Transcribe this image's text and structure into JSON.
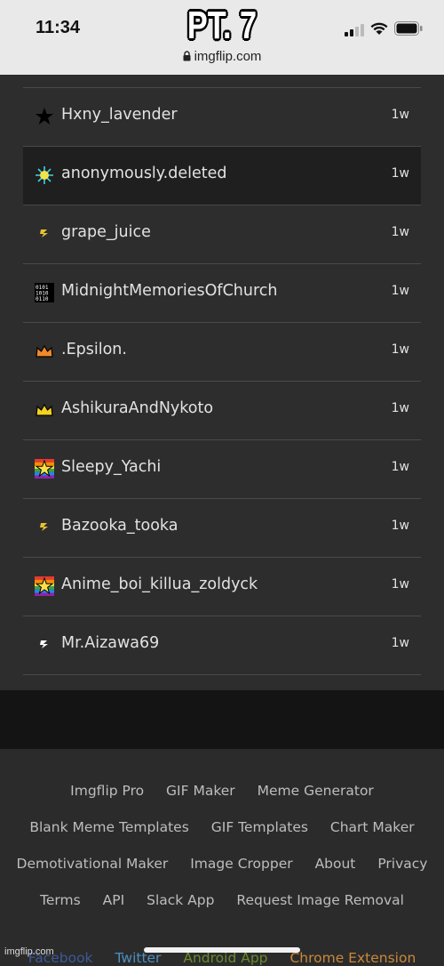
{
  "status": {
    "time": "11:34",
    "url": "imgflip.com"
  },
  "caption": "PT. 7",
  "users": [
    {
      "name": "Hxny_lavender",
      "time": "1w",
      "icon": "star-icon",
      "active": false
    },
    {
      "name": "anonymously.deleted",
      "time": "1w",
      "icon": "sun-icon",
      "active": true
    },
    {
      "name": "grape_juice",
      "time": "1w",
      "icon": "bolt-icon",
      "active": false
    },
    {
      "name": "MidnightMemoriesOfChurch",
      "time": "1w",
      "icon": "binary-icon",
      "active": false
    },
    {
      "name": ".Epsilon.",
      "time": "1w",
      "icon": "crown-orange-icon",
      "active": false
    },
    {
      "name": "AshikuraAndNykoto",
      "time": "1w",
      "icon": "crown-gold-icon",
      "active": false
    },
    {
      "name": "Sleepy_Yachi",
      "time": "1w",
      "icon": "rainbow-star-icon",
      "active": false
    },
    {
      "name": "Bazooka_tooka",
      "time": "1w",
      "icon": "bolt-icon",
      "active": false
    },
    {
      "name": "Anime_boi_killua_zoldyck",
      "time": "1w",
      "icon": "rainbow-star-icon",
      "active": false
    },
    {
      "name": "Mr.Aizawa69",
      "time": "1w",
      "icon": "bolt-white-icon",
      "active": false
    }
  ],
  "footer": {
    "row1": [
      "Imgflip Pro",
      "GIF Maker",
      "Meme Generator"
    ],
    "row2": [
      "Blank Meme Templates",
      "GIF Templates",
      "Chart Maker"
    ],
    "row3": [
      "Demotivational Maker",
      "Image Cropper",
      "About",
      "Privacy"
    ],
    "row4": [
      "Terms",
      "API",
      "Slack App",
      "Request Image Removal"
    ],
    "row5": [
      "Facebook",
      "Twitter",
      "Android App",
      "Chrome Extension"
    ]
  },
  "watermark": "imgflip.com",
  "colors": {
    "facebook": "#3b5998",
    "twitter": "#4a90c2",
    "android": "#6a8a2c",
    "chrome": "#c9883a"
  }
}
